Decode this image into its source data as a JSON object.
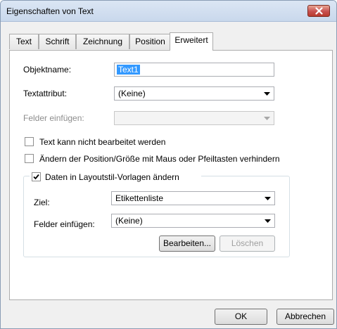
{
  "window": {
    "title": "Eigenschaften von Text"
  },
  "tabs": [
    {
      "label": "Text"
    },
    {
      "label": "Schrift"
    },
    {
      "label": "Zeichnung"
    },
    {
      "label": "Position"
    },
    {
      "label": "Erweitert"
    }
  ],
  "active_tab": "Erweitert",
  "form": {
    "objektname_label": "Objektname:",
    "objektname_value": "Text1",
    "textattribut_label": "Textattribut:",
    "textattribut_value": "(Keine)",
    "felder_einfuegen_label": "Felder einfügen:",
    "felder_einfuegen_value": "",
    "lock_text_label": "Text kann nicht bearbeitet werden",
    "lock_text_checked": false,
    "lock_position_label": "Ändern der Position/Größe mit Maus oder Pfeiltasten verhindern",
    "lock_position_checked": false
  },
  "group": {
    "checkbox_label": "Daten in Layoutstil-Vorlagen ändern",
    "checkbox_checked": true,
    "ziel_label": "Ziel:",
    "ziel_value": "Etikettenliste",
    "felder_label": "Felder einfügen:",
    "felder_value": "(Keine)",
    "edit_button": "Bearbeiten...",
    "delete_button": "Löschen"
  },
  "footer": {
    "ok_button": "OK",
    "cancel_button": "Abbrechen"
  },
  "colors": {
    "selection": "#3399ff",
    "close_button": "#c75050",
    "titlebar": "#dbe6f4"
  }
}
